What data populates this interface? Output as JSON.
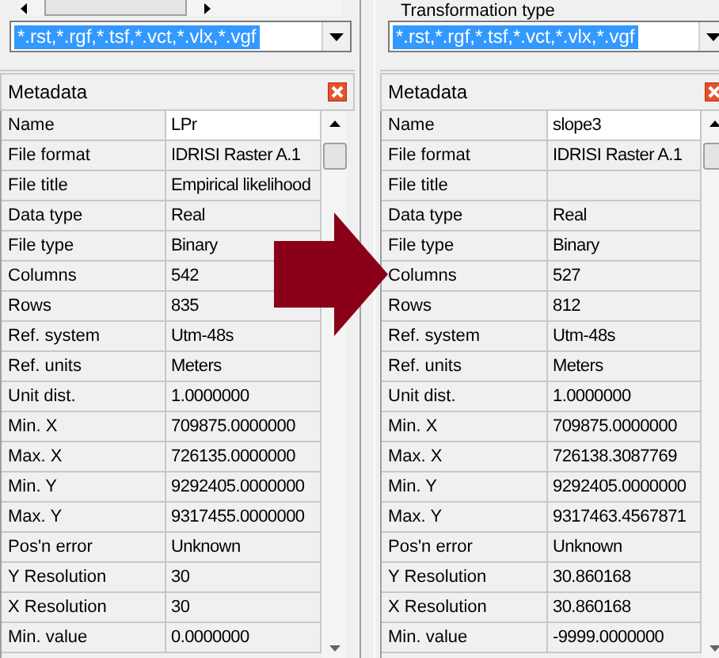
{
  "panels": [
    {
      "filter": {
        "value": "*.rst,*.rgf,*.tsf,*.vct,*.vlx,*.vgf",
        "text_selected": true
      },
      "metadata_title": "Metadata",
      "rows": [
        {
          "label": "Name",
          "value": "LPr",
          "editable": true
        },
        {
          "label": "File format",
          "value": "IDRISI Raster A.1"
        },
        {
          "label": "File title",
          "value": "Empirical likelihood"
        },
        {
          "label": "Data type",
          "value": "Real"
        },
        {
          "label": "File type",
          "value": "Binary"
        },
        {
          "label": "Columns",
          "value": "542"
        },
        {
          "label": "Rows",
          "value": "835"
        },
        {
          "label": "Ref. system",
          "value": "Utm-48s"
        },
        {
          "label": "Ref. units",
          "value": "Meters"
        },
        {
          "label": "Unit dist.",
          "value": "1.0000000"
        },
        {
          "label": "Min. X",
          "value": "709875.0000000"
        },
        {
          "label": "Max. X",
          "value": "726135.0000000"
        },
        {
          "label": "Min. Y",
          "value": "9292405.0000000"
        },
        {
          "label": "Max. Y",
          "value": "9317455.0000000"
        },
        {
          "label": "Pos'n error",
          "value": "Unknown"
        },
        {
          "label": "Y Resolution",
          "value": "30"
        },
        {
          "label": "X Resolution",
          "value": "30"
        },
        {
          "label": "Min. value",
          "value": "0.0000000"
        }
      ]
    },
    {
      "group_label": "Transformation type",
      "filter": {
        "value": "*.rst,*.rgf,*.tsf,*.vct,*.vlx,*.vgf",
        "text_selected": true
      },
      "metadata_title": "Metadata",
      "rows": [
        {
          "label": "Name",
          "value": "slope3",
          "editable": true
        },
        {
          "label": "File format",
          "value": "IDRISI Raster A.1"
        },
        {
          "label": "File title"
        },
        {
          "label": "Data type",
          "value": "Real"
        },
        {
          "label": "File type",
          "value": "Binary"
        },
        {
          "label": "Columns",
          "value": "527"
        },
        {
          "label": "Rows",
          "value": "812"
        },
        {
          "label": "Ref. system",
          "value": "Utm-48s"
        },
        {
          "label": "Ref. units",
          "value": "Meters"
        },
        {
          "label": "Unit dist.",
          "value": "1.0000000"
        },
        {
          "label": "Min. X",
          "value": "709875.0000000"
        },
        {
          "label": "Max. X",
          "value": "726138.3087769"
        },
        {
          "label": "Min. Y",
          "value": "9292405.0000000"
        },
        {
          "label": "Max. Y",
          "value": "9317463.4567871"
        },
        {
          "label": "Pos'n error",
          "value": "Unknown"
        },
        {
          "label": "Y Resolution",
          "value": "30.860168"
        },
        {
          "label": "X Resolution",
          "value": "30.860168"
        },
        {
          "label": "Min. value",
          "value": "-9999.0000000"
        }
      ]
    }
  ]
}
